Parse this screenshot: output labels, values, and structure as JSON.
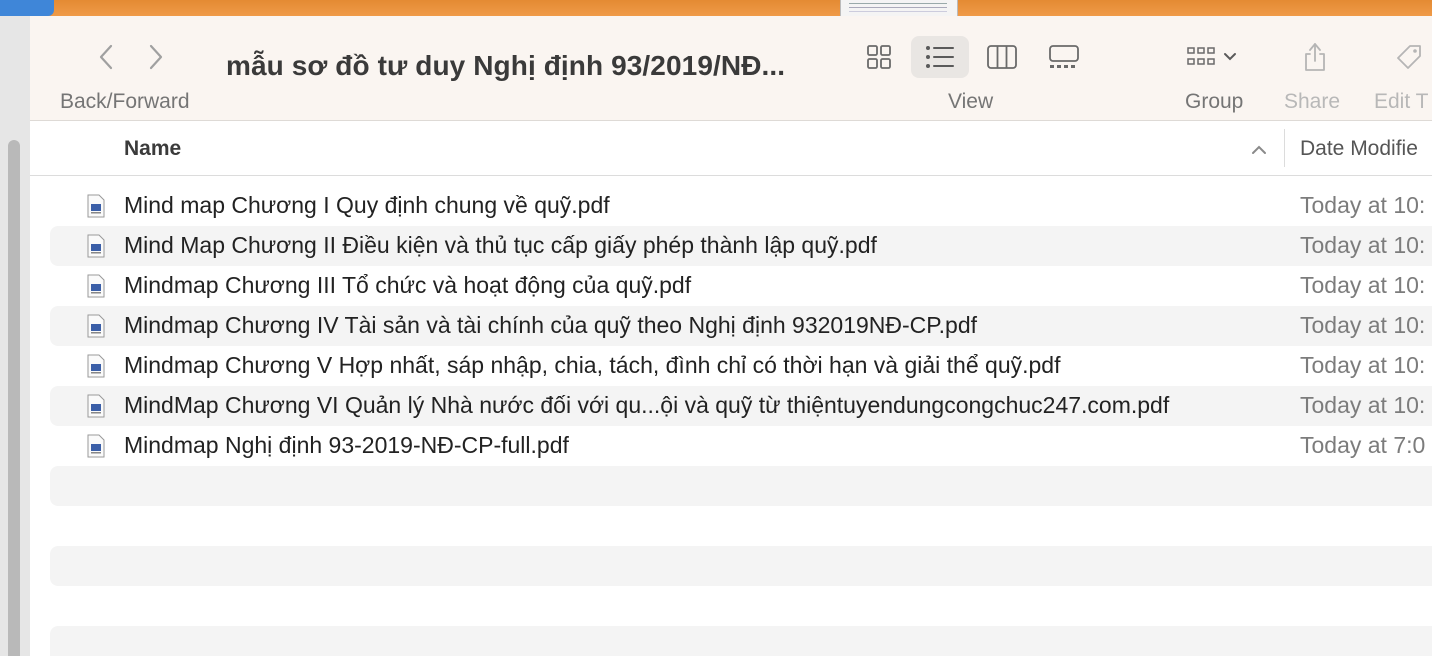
{
  "toolbar": {
    "back_forward_label": "Back/Forward",
    "title": "mẫu sơ đồ tư duy Nghị định 93/2019/NĐ...",
    "view_label": "View",
    "group_label": "Group",
    "share_label": "Share",
    "edit_label": "Edit T"
  },
  "columns": {
    "name": "Name",
    "date_modified": "Date Modifie"
  },
  "files": [
    {
      "name": "Mind map Chương I Quy định chung về quỹ.pdf",
      "date": "Today at 10:"
    },
    {
      "name": "Mind Map Chương II Điều kiện và thủ tục cấp giấy phép thành lập quỹ.pdf",
      "date": "Today at 10:"
    },
    {
      "name": "Mindmap Chương III Tổ chức và hoạt động của quỹ.pdf",
      "date": "Today at 10:"
    },
    {
      "name": "Mindmap Chương IV Tài sản và tài chính của quỹ theo Nghị định 932019NĐ-CP.pdf",
      "date": "Today at 10:"
    },
    {
      "name": "Mindmap Chương V Hợp nhất, sáp nhập, chia, tách, đình chỉ có thời hạn và giải thể quỹ.pdf",
      "date": "Today at 10:"
    },
    {
      "name": "MindMap Chương VI Quản lý Nhà nước đối với qu...ội và quỹ từ thiệntuyendungcongchuc247.com.pdf",
      "date": "Today at 10:"
    },
    {
      "name": "Mindmap Nghị định 93-2019-NĐ-CP-full.pdf",
      "date": "Today at 7:0"
    }
  ],
  "colors": {
    "desktop_orange": "#e88e3a",
    "toolbar_bg": "#faf5f1",
    "alt_row": "#f4f4f4"
  },
  "icons": [
    "chevron-left-icon",
    "chevron-right-icon",
    "grid-view-icon",
    "list-view-icon",
    "column-view-icon",
    "gallery-view-icon",
    "group-icon",
    "chevron-down-icon",
    "share-icon",
    "tag-icon",
    "sort-ascending-icon",
    "pdf-file-icon"
  ]
}
